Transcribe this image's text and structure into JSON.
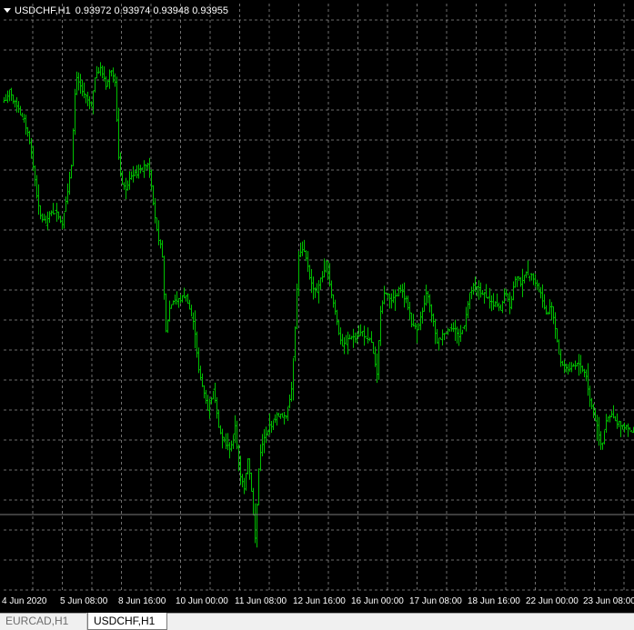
{
  "chart": {
    "symbol": "USDCHF,H1",
    "ohlc": "0.93972 0.93974 0.93948 0.93955",
    "colors": {
      "background": "#000000",
      "grid": "#c8c8c8",
      "bars": "#00c000",
      "text": "#ffffff",
      "level_line": "#7a7a7a"
    }
  },
  "x_axis": {
    "labels": [
      "4 Jun 2020",
      "5 Jun 08:00",
      "8 Jun 16:00",
      "10 Jun 00:00",
      "11 Jun 08:00",
      "12 Jun 16:00",
      "16 Jun 00:00",
      "17 Jun 08:00",
      "18 Jun 16:00",
      "22 Jun 00:00",
      "23 Jun 08:00"
    ]
  },
  "tabs": [
    {
      "label": "EURCAD,H1",
      "active": false
    },
    {
      "label": "USDCHF,H1",
      "active": true
    }
  ]
}
